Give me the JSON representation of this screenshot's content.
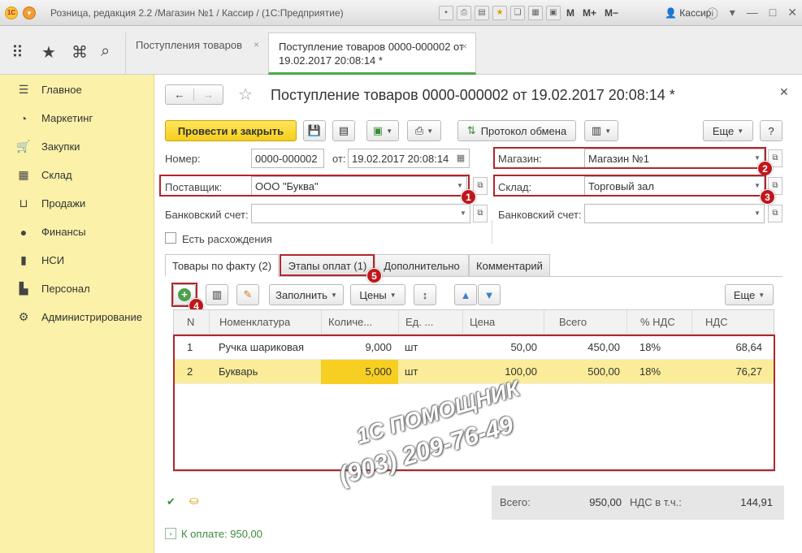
{
  "window": {
    "title": "Розница, редакция 2.2 /Магазин №1 / Кассир /  (1С:Предприятие)",
    "user": "Кассир",
    "m_labels": [
      "M",
      "M+",
      "M−"
    ]
  },
  "tabs": [
    {
      "label": "Поступления товаров"
    },
    {
      "label": "Поступление товаров 0000-000002 от 19.02.2017 20:08:14 *"
    }
  ],
  "sidebar": {
    "items": [
      {
        "label": "Главное",
        "icon": "list-icon"
      },
      {
        "label": "Маркетинг",
        "icon": "pie-chart-icon"
      },
      {
        "label": "Закупки",
        "icon": "cart-icon"
      },
      {
        "label": "Склад",
        "icon": "warehouse-icon"
      },
      {
        "label": "Продажи",
        "icon": "basket-icon"
      },
      {
        "label": "Финансы",
        "icon": "coin-icon"
      },
      {
        "label": "НСИ",
        "icon": "book-icon"
      },
      {
        "label": "Персонал",
        "icon": "person-icon"
      },
      {
        "label": "Администрирование",
        "icon": "gear-icon"
      }
    ]
  },
  "form": {
    "title": "Поступление товаров 0000-000002 от 19.02.2017 20:08:14 *",
    "toolbar": {
      "post_close": "Провести и закрыть",
      "exchange_log": "Протокол обмена",
      "more": "Еще",
      "help": "?"
    },
    "fields": {
      "number_label": "Номер:",
      "number_value": "0000-000002",
      "date_label": "от:",
      "date_value": "19.02.2017 20:08:14",
      "store_label": "Магазин:",
      "store_value": "Магазин №1",
      "supplier_label": "Поставщик:",
      "supplier_value": "ООО \"Буква\"",
      "warehouse_label": "Склад:",
      "warehouse_value": "Торговый зал",
      "bank_label": "Банковский счет:",
      "bank_value": "",
      "bank2_label": "Банковский счет:",
      "bank2_value": "",
      "discrepancy_label": "Есть расхождения"
    },
    "badges": [
      "1",
      "2",
      "3",
      "4",
      "5"
    ],
    "page_tabs": [
      {
        "label": "Товары по факту (2)"
      },
      {
        "label": "Этапы оплат (1)"
      },
      {
        "label": "Дополнительно"
      },
      {
        "label": "Комментарий"
      }
    ],
    "table_toolbar": {
      "fill": "Заполнить",
      "prices": "Цены",
      "more": "Еще"
    },
    "table": {
      "columns": [
        "N",
        "Номенклатура",
        "Количе...",
        "Ед. ...",
        "Цена",
        "Всего",
        "% НДС",
        "НДС"
      ],
      "rows": [
        {
          "n": "1",
          "item": "Ручка шариковая",
          "qty": "9,000",
          "unit": "шт",
          "price": "50,00",
          "total": "450,00",
          "vat_rate": "18%",
          "vat": "68,64"
        },
        {
          "n": "2",
          "item": "Букварь",
          "qty": "5,000",
          "unit": "шт",
          "price": "100,00",
          "total": "500,00",
          "vat_rate": "18%",
          "vat": "76,27"
        }
      ]
    },
    "totals": {
      "total_label": "Всего:",
      "total_value": "950,00",
      "vat_label": "НДС в т.ч.:",
      "vat_value": "144,91"
    },
    "to_pay": "К оплате: 950,00",
    "watermark": {
      "line1": "1С ПОМОЩНИК",
      "line2": "(903) 209-76-49"
    }
  },
  "colors": {
    "accent_yellow": "#f5cf1c",
    "sidebar_bg": "#fbf1a9",
    "highlight_red": "#b0262c",
    "selected_row": "#fbec99",
    "active_tab_underline": "#4aa84a"
  }
}
